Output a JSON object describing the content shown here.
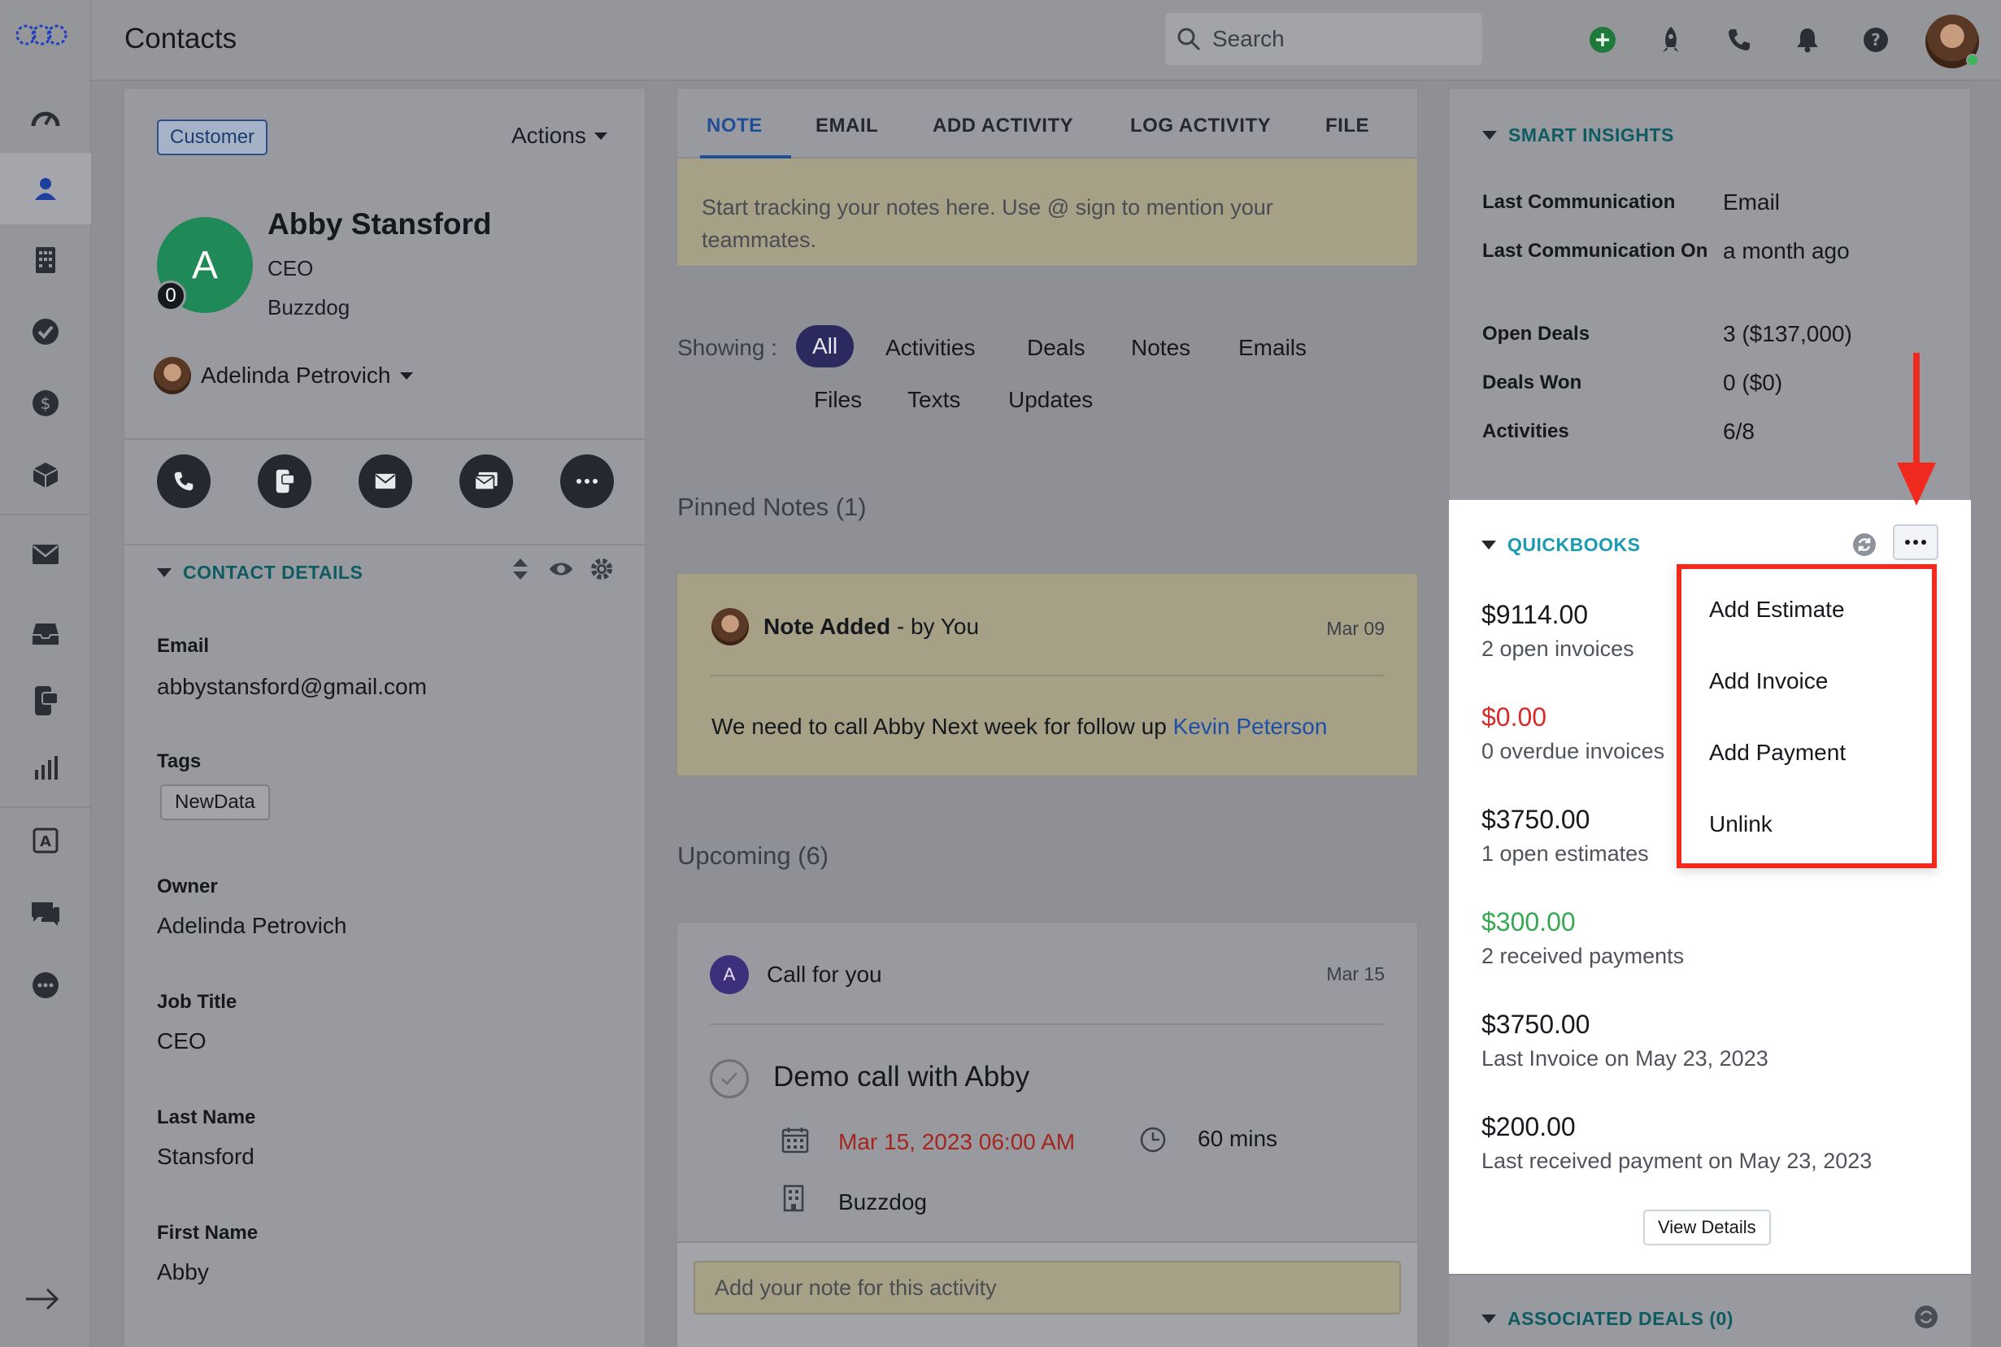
{
  "header": {
    "title": "Contacts",
    "search_placeholder": "Search"
  },
  "contact": {
    "badge": "Customer",
    "actions_label": "Actions",
    "initial": "A",
    "avatar_count": "0",
    "name": "Abby Stansford",
    "role": "CEO",
    "company": "Buzzdog",
    "owner": "Adelinda Petrovich"
  },
  "contact_details": {
    "heading": "CONTACT DETAILS",
    "fields": [
      {
        "label": "Email",
        "value": "abbystansford@gmail.com"
      },
      {
        "label": "Tags",
        "value": "NewData"
      },
      {
        "label": "Owner",
        "value": "Adelinda Petrovich"
      },
      {
        "label": "Job Title",
        "value": "CEO"
      },
      {
        "label": "Last Name",
        "value": "Stansford"
      },
      {
        "label": "First Name",
        "value": "Abby"
      }
    ]
  },
  "compose": {
    "tabs": [
      "NOTE",
      "EMAIL",
      "ADD ACTIVITY",
      "LOG ACTIVITY",
      "FILE"
    ],
    "note_placeholder": "Start tracking your notes here. Use @ sign to mention your teammates."
  },
  "feed": {
    "showing_label": "Showing :",
    "filters": [
      "All",
      "Activities",
      "Deals",
      "Notes",
      "Emails",
      "Files",
      "Texts",
      "Updates"
    ],
    "pinned_title": "Pinned Notes (1)",
    "pinned_note": {
      "title": "Note Added",
      "by": "- by You",
      "date": "Mar 09",
      "body": "We need to call Abby Next week for follow up ",
      "mention": "Kevin Peterson"
    },
    "upcoming_title": "Upcoming (6)",
    "upcoming": {
      "initial": "A",
      "type": "Call",
      "for": "for you",
      "date": "Mar 15",
      "title": "Demo call with Abby",
      "when": "Mar 15, 2023 06:00 AM",
      "duration": "60 mins",
      "company": "Buzzdog",
      "note_placeholder": "Add your note for this activity"
    }
  },
  "smart_insights": {
    "heading": "SMART INSIGHTS",
    "rows": [
      {
        "label": "Last Communication",
        "value": "Email"
      },
      {
        "label": "Last Communication On",
        "value": "a month ago"
      },
      {
        "label": "Open Deals",
        "value": "3 ($137,000)"
      },
      {
        "label": "Deals Won",
        "value": "0 ($0)"
      },
      {
        "label": "Activities",
        "value": "6/8"
      }
    ]
  },
  "quickbooks": {
    "heading": "QUICKBOOKS",
    "stats": [
      {
        "amount": "$9114.00",
        "label": "2 open invoices"
      },
      {
        "amount": "$0.00",
        "label": "0 overdue invoices"
      },
      {
        "amount": "$3750.00",
        "label": "1 open estimates"
      },
      {
        "amount": "$300.00",
        "label": "2 received payments"
      },
      {
        "amount": "$3750.00",
        "label": "Last Invoice on May 23, 2023"
      },
      {
        "amount": "$200.00",
        "label": "Last received payment on May 23, 2023"
      }
    ],
    "view_details": "View Details",
    "menu": [
      "Add Estimate",
      "Add Invoice",
      "Add Payment",
      "Unlink"
    ],
    "colors": {
      "overdue": "#d62b2b",
      "received": "#37a852",
      "highlight": "#f02a1f"
    }
  },
  "associated_deals": {
    "heading": "ASSOCIATED DEALS (0)"
  },
  "icons": {
    "sidebar": [
      "logo-icon",
      "dashboard-icon",
      "contacts-icon",
      "accounts-icon",
      "tasks-icon",
      "deals-icon",
      "products-icon",
      "email-icon",
      "inbox-icon",
      "sms-icon",
      "reports-icon",
      "automation-icon",
      "chat-icon",
      "more-icon",
      "expand-arrow-icon"
    ],
    "header": [
      "search-icon",
      "add-icon",
      "rocket-icon",
      "phone-icon",
      "bell-icon",
      "help-icon",
      "profile-avatar"
    ]
  }
}
